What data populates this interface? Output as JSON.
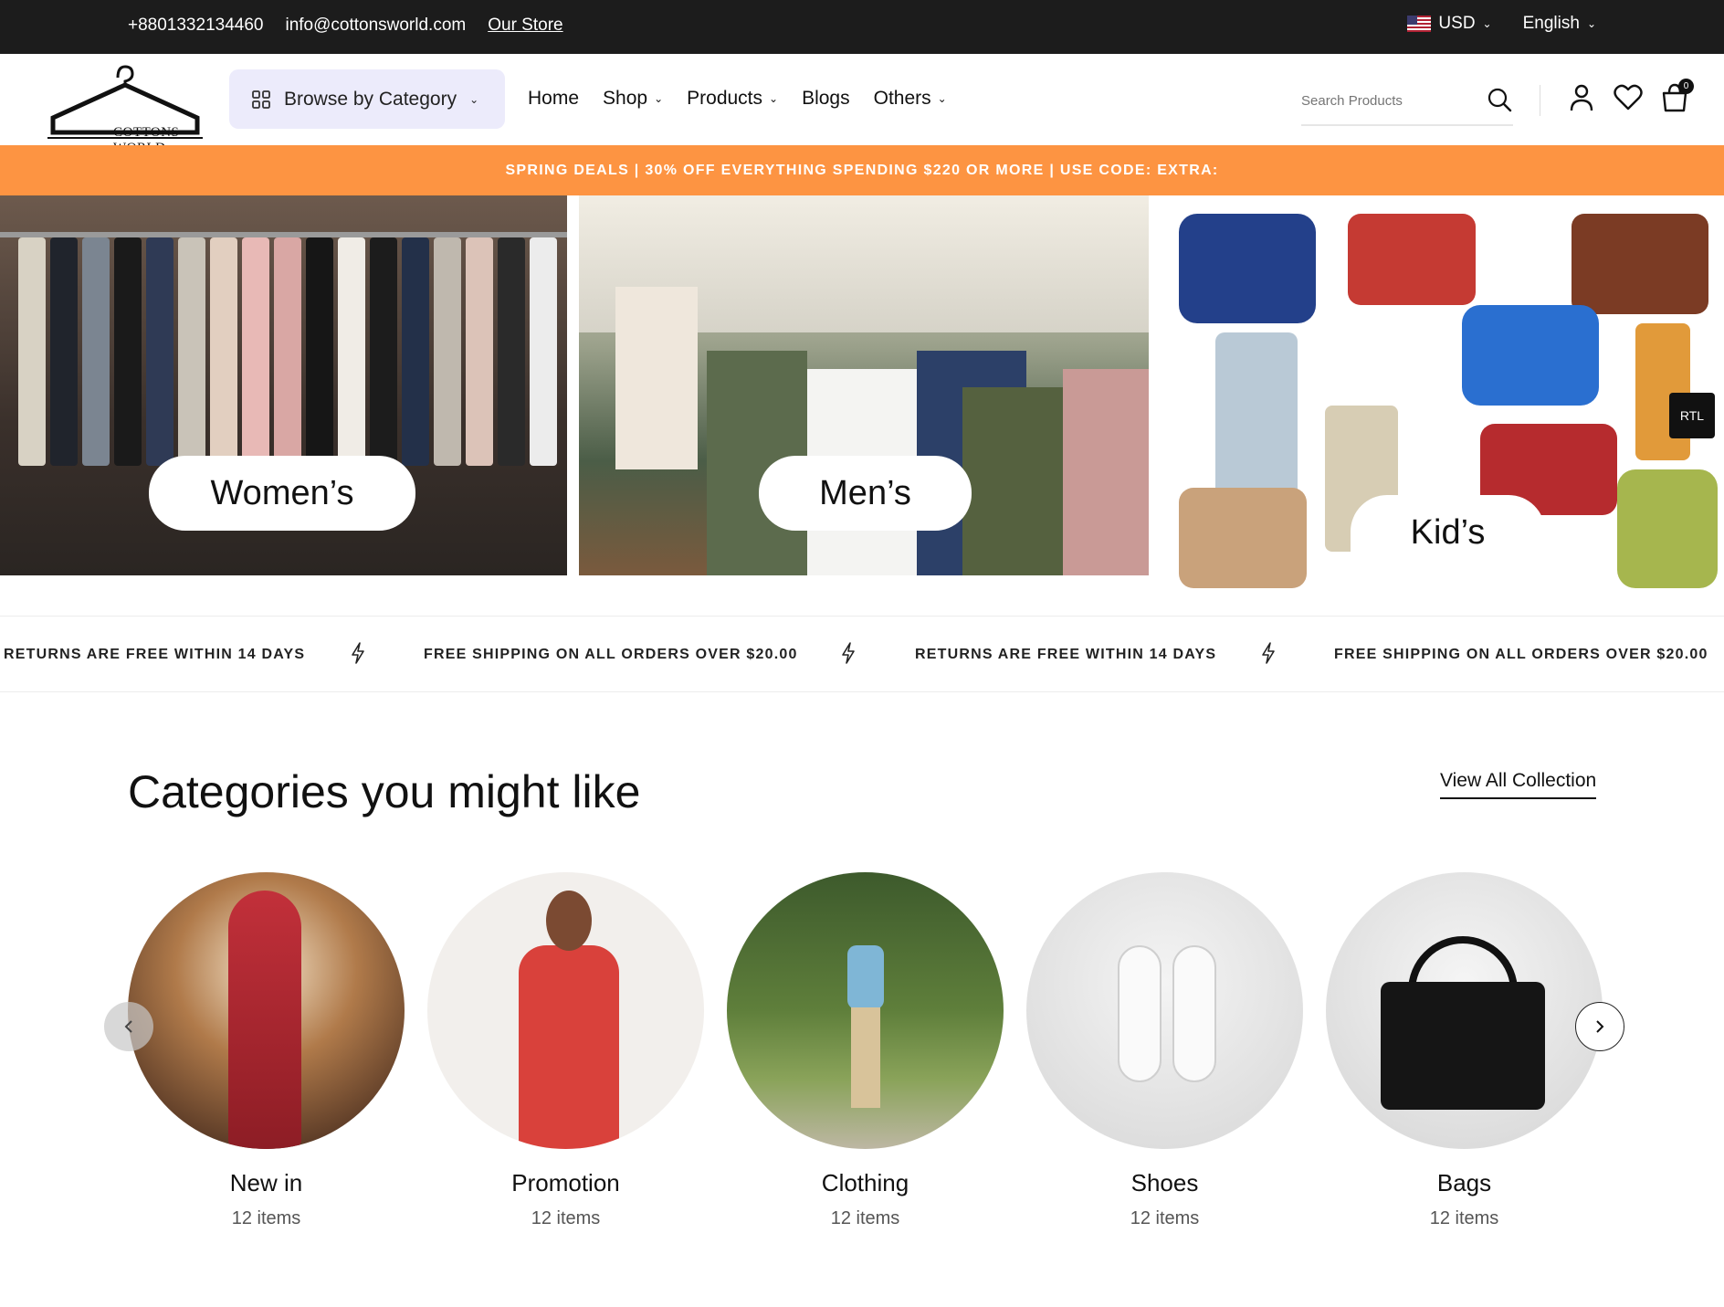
{
  "topbar": {
    "phone": "+8801332134460",
    "email": "info@cottonsworld.com",
    "store_link": "Our Store",
    "currency": "USD",
    "language": "English"
  },
  "header": {
    "logo_text": "COTTONS WORLD",
    "browse_label": "Browse by Category",
    "nav": [
      "Home",
      "Shop",
      "Products",
      "Blogs",
      "Others"
    ],
    "search_placeholder": "Search Products",
    "cart_count": "0"
  },
  "promo": {
    "text": "SPRING DEALS | 30% OFF EVERYTHING SPENDING $220 OR MORE | USE CODE: EXTRA:"
  },
  "hero": {
    "women_label": "Women’s",
    "men_label": "Men’s",
    "kids_label": "Kid’s",
    "rtl_label": "RTL"
  },
  "marquee": {
    "items": [
      "RETURNS ARE FREE WITHIN 14 DAYS",
      "FREE SHIPPING ON ALL ORDERS OVER $20.00",
      "RETURNS ARE FREE WITHIN 14 DAYS",
      "FREE SHIPPING ON ALL ORDERS OVER $20.00"
    ]
  },
  "categories": {
    "title": "Categories you might like",
    "view_all": "View All Collection",
    "items": [
      {
        "name": "New in",
        "count": "12 items"
      },
      {
        "name": "Promotion",
        "count": "12 items"
      },
      {
        "name": "Clothing",
        "count": "12 items"
      },
      {
        "name": "Shoes",
        "count": "12 items"
      },
      {
        "name": "Bags",
        "count": "12 items"
      }
    ]
  },
  "colors": {
    "promo_bg": "#fd9442",
    "topbar_bg": "#1c1c1c",
    "browse_bg": "#ecebfb"
  }
}
